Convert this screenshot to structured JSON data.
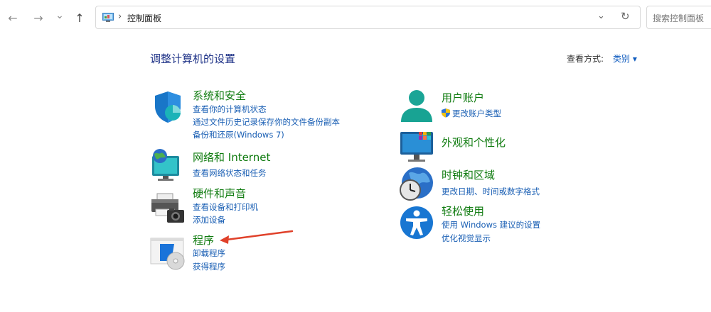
{
  "nav": {
    "back": "←",
    "forward": "→",
    "recent": "⌄",
    "up": "↑"
  },
  "address": {
    "crumb": "控制面板",
    "separator": "›",
    "dropdown": "⌄",
    "refresh": "↻"
  },
  "search": {
    "placeholder": "搜索控制面板"
  },
  "header": {
    "title": "调整计算机的设置",
    "view_by_label": "查看方式:",
    "view_by_value": "类别 ▾"
  },
  "categories_left": [
    {
      "title": "系统和安全",
      "links": [
        "查看你的计算机状态",
        "通过文件历史记录保存你的文件备份副本",
        "备份和还原(Windows 7)"
      ],
      "icon": "shield-icon"
    },
    {
      "title": "网络和 Internet",
      "links": [
        "查看网络状态和任务"
      ],
      "icon": "network-globe-icon"
    },
    {
      "title": "硬件和声音",
      "links": [
        "查看设备和打印机",
        "添加设备"
      ],
      "icon": "printer-camera-icon"
    },
    {
      "title": "程序",
      "links": [
        "卸载程序",
        "获得程序"
      ],
      "icon": "programs-disc-icon"
    }
  ],
  "categories_right": [
    {
      "title": "用户账户",
      "links": [
        "更改账户类型"
      ],
      "icon": "user-icon"
    },
    {
      "title": "外观和个性化",
      "links": [],
      "icon": "monitor-icon"
    },
    {
      "title": "时钟和区域",
      "links": [
        "更改日期、时间或数字格式"
      ],
      "icon": "clock-globe-icon"
    },
    {
      "title": "轻松使用",
      "links": [
        "使用 Windows 建议的设置",
        "优化视觉显示"
      ],
      "icon": "accessibility-icon"
    }
  ],
  "colors": {
    "category_title": "#0f7b0f",
    "link": "#1a5fb4",
    "page_title": "#1e3287",
    "annotation_arrow": "#e0412a"
  }
}
